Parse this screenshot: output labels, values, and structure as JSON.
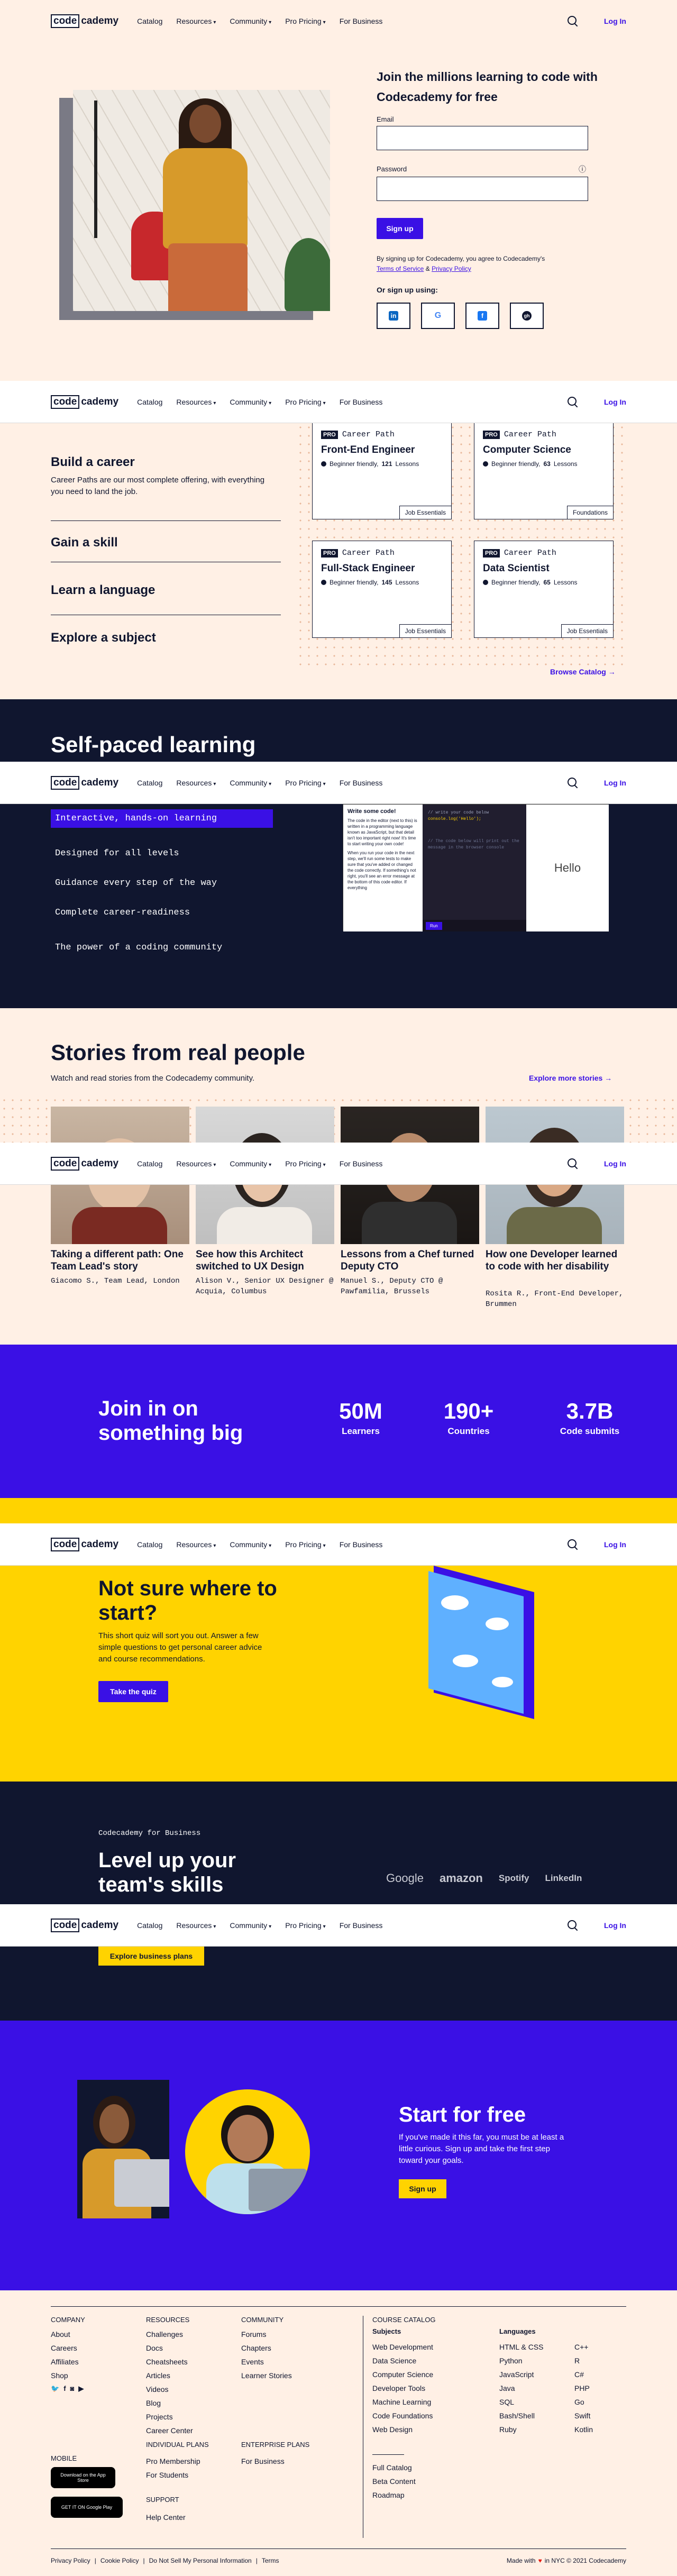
{
  "nav": {
    "logo_code": "code",
    "logo_academy": "cademy",
    "catalog": "Catalog",
    "resources": "Resources",
    "community": "Community",
    "pricing": "Pro Pricing",
    "business": "For Business",
    "login": "Log In",
    "caret": "▾"
  },
  "hero": {
    "heading": "Join the millions learning to code with Codecademy for free",
    "email_label": "Email",
    "password_label": "Password",
    "info_icon": "ⓘ",
    "signup": "Sign up",
    "terms_prefix": "By signing up for Codecademy, you agree to Codecademy's",
    "terms_link": "Terms of Service",
    "and": "&",
    "privacy_link": "Privacy Policy",
    "or_signup": "Or sign up using:",
    "social": [
      "in",
      "G",
      "f",
      "gh"
    ]
  },
  "paths": {
    "items": [
      "Build a career",
      "Gain a skill",
      "Learn a language",
      "Explore a subject"
    ],
    "build_desc": "Career Paths are our most complete offering, with everything you need to land the job.",
    "cards": [
      {
        "pro": "PRO",
        "kind": "Career Path",
        "title": "Front-End Engineer",
        "meta_level": "Beginner friendly,",
        "meta_count": "121",
        "meta_unit": "Lessons",
        "tag": "Job Essentials"
      },
      {
        "pro": "PRO",
        "kind": "Career Path",
        "title": "Computer Science",
        "meta_level": "Beginner friendly,",
        "meta_count": "63",
        "meta_unit": "Lessons",
        "tag": "Foundations"
      },
      {
        "pro": "PRO",
        "kind": "Career Path",
        "title": "Full-Stack Engineer",
        "meta_level": "Beginner friendly,",
        "meta_count": "145",
        "meta_unit": "Lessons",
        "tag": "Job Essentials"
      },
      {
        "pro": "PRO",
        "kind": "Career Path",
        "title": "Data Scientist",
        "meta_level": "Beginner friendly,",
        "meta_count": "65",
        "meta_unit": "Lessons",
        "tag": "Job Essentials"
      }
    ],
    "browse": "Browse Catalog →"
  },
  "selfpaced": {
    "heading": "Self-paced learning",
    "features": [
      "Interactive, hands-on learning",
      "Designed for all levels",
      "Guidance every step of the way",
      "Complete career-readiness",
      "The power of a coding community"
    ],
    "editor_title": "Write some code!",
    "editor_text": "The code in the editor (next to this) is written in a programming language known as JavaScript, but that detail isn't too important right now! It's time to start writing your own code!",
    "editor_text2": "When you run your code in the next step, we'll run some tests to make sure that you've added or changed the code correctly. If something's not right, you'll see an error message at the bottom of this code editor. If everything",
    "code_line1": "// write your code below",
    "code_line2": "console.log('Hello');",
    "code_comment": "// The code below will print out the message in the browser console",
    "output": "Hello",
    "run": "Run"
  },
  "stories": {
    "heading": "Stories from real people",
    "sub": "Watch and read stories from the Codecademy community.",
    "more": "Explore more stories →",
    "items": [
      {
        "title": "Taking a different path: One Team Lead's story",
        "sub": "Giacomo S., Team Lead, London"
      },
      {
        "title": "See how this Architect switched to UX Design",
        "sub": "Alison V., Senior UX Designer @ Acquia, Columbus"
      },
      {
        "title": "Lessons from a Chef turned Deputy CTO",
        "sub": "Manuel S., Deputy CTO @ Pawfamilia, Brussels"
      },
      {
        "title": "How one Developer learned to code with her disability",
        "sub": "Rosita R., Front-End Developer, Brummen"
      }
    ]
  },
  "join": {
    "heading": "Join in on something big",
    "stats": [
      {
        "num": "50M",
        "label": "Learners"
      },
      {
        "num": "190+",
        "label": "Countries"
      },
      {
        "num": "3.7B",
        "label": "Code submits"
      }
    ]
  },
  "quiz": {
    "heading": "Not sure where to start?",
    "desc": "This short quiz will sort you out. Answer a few simple questions to get personal career advice and course recommendations.",
    "button": "Take the quiz"
  },
  "business": {
    "eyebrow": "Codecademy for Business",
    "heading": "Level up your team's skills",
    "logos": [
      "Google",
      "amazon",
      "Spotify",
      "LinkedIn"
    ],
    "button": "Explore business plans"
  },
  "start": {
    "heading": "Start for free",
    "desc": "If you've made it this far, you must be at least a little curious. Sign up and take the first step toward your goals.",
    "button": "Sign up"
  },
  "footer": {
    "company_head": "Company",
    "company": [
      "About",
      "Careers",
      "Affiliates",
      "Shop"
    ],
    "resources_head": "Resources",
    "resources": [
      "Challenges",
      "Docs",
      "Cheatsheets",
      "Articles",
      "Videos",
      "Blog",
      "Projects",
      "Career Center"
    ],
    "community_head": "Community",
    "community": [
      "Forums",
      "Chapters",
      "Events",
      "Learner Stories"
    ],
    "individual_head": "Individual Plans",
    "individual": [
      "Pro Membership",
      "For Students"
    ],
    "enterprise_head": "Enterprise Plans",
    "enterprise": [
      "For Business"
    ],
    "support_head": "Support",
    "support": [
      "Help Center"
    ],
    "mobile_head": "Mobile",
    "app_store": "Download on the App Store",
    "google_play": "GET IT ON Google Play",
    "catalog_head": "Course Catalog",
    "subjects_head": "Subjects",
    "subjects": [
      "Web Development",
      "Data Science",
      "Computer Science",
      "Developer Tools",
      "Machine Learning",
      "Code Foundations",
      "Web Design"
    ],
    "languages_head": "Languages",
    "languages_a": [
      "HTML & CSS",
      "Python",
      "JavaScript",
      "Java",
      "SQL",
      "Bash/Shell",
      "Ruby"
    ],
    "languages_b": [
      "C++",
      "R",
      "C#",
      "PHP",
      "Go",
      "Swift",
      "Kotlin"
    ],
    "catalog_links": [
      "Full Catalog",
      "Beta Content",
      "Roadmap"
    ],
    "bottom": [
      "Privacy Policy",
      "Cookie Policy",
      "Do Not Sell My Personal Information",
      "Terms"
    ],
    "made_prefix": "Made with",
    "made_suffix": "in NYC © 2021 Codecademy"
  },
  "colors": {
    "brand": "#3a10e5",
    "navy": "#10162f",
    "yellow": "#ffd300",
    "cream": "#fff0e5"
  }
}
